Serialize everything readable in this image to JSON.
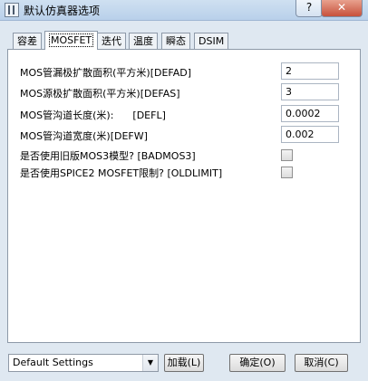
{
  "window": {
    "title": "默认仿真器选项",
    "help_label": "?",
    "close_label": "✕"
  },
  "tabs": [
    {
      "label": "容差",
      "active": false
    },
    {
      "label": "MOSFET",
      "active": true
    },
    {
      "label": "迭代",
      "active": false
    },
    {
      "label": "温度",
      "active": false
    },
    {
      "label": "瞬态",
      "active": false
    },
    {
      "label": "DSIM",
      "active": false
    }
  ],
  "mosfet": {
    "rows": [
      {
        "label": "MOS管漏极扩散面积(平方米)[DEFAD]",
        "value": "2"
      },
      {
        "label": "MOS源极扩散面积(平方米)[DEFAS]",
        "value": "3"
      },
      {
        "label": "MOS管沟道长度(米):      [DEFL]",
        "value": "0.0002"
      },
      {
        "label": "MOS管沟道宽度(米)[DEFW]",
        "value": "0.002"
      }
    ],
    "checks": [
      {
        "label": "是否使用旧版MOS3模型? [BADMOS3]",
        "checked": false
      },
      {
        "label": "是否使用SPICE2 MOSFET限制? [OLDLIMIT]",
        "checked": false
      }
    ]
  },
  "footer": {
    "settings_select": "Default Settings",
    "load_button": "加载(L)",
    "ok_button": "确定(O)",
    "cancel_button": "取消(C)"
  },
  "icons": {
    "app": "app-icon",
    "dropdown": "chevron-down-icon"
  }
}
